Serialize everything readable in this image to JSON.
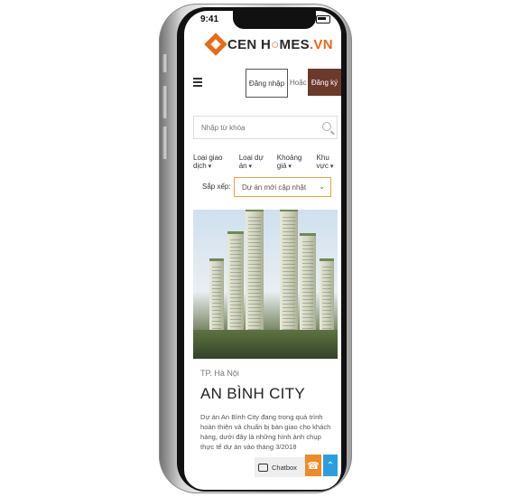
{
  "status_bar": {
    "time": "9:41"
  },
  "logo": {
    "brand": "CEN H",
    "brand2": "MES",
    "suffix": ".VN",
    "accent_color": "#e86a17"
  },
  "header": {
    "menu_icon": "hamburger-icon",
    "login_label": "Đăng nhập",
    "or_label": "Hoặc",
    "register_label": "Đăng ký",
    "register_color": "#6b3a2a"
  },
  "search": {
    "placeholder": "Nhập từ khóa",
    "icon": "search-icon"
  },
  "filters": [
    {
      "label": "Loại giao dịch"
    },
    {
      "label": "Loại dự án"
    },
    {
      "label": "Khoảng giá"
    },
    {
      "label": "Khu vực"
    }
  ],
  "sort": {
    "label": "Sắp xếp:",
    "selected": "Dự án mới cập nhật"
  },
  "listing": {
    "location": "TP. Hà Nội",
    "title": "AN BÌNH CITY",
    "description": "Dự án An Bình City đang trong quá trình hoàn thiện và chuẩn bị bàn giao cho khách hàng, dưới đây là những hình ảnh chụp thực tế dự án vào tháng 3/2018"
  },
  "floating": {
    "chatbox_label": "Chatbox",
    "phone_icon": "phone-icon",
    "top_icon": "chevron-up-icon"
  }
}
